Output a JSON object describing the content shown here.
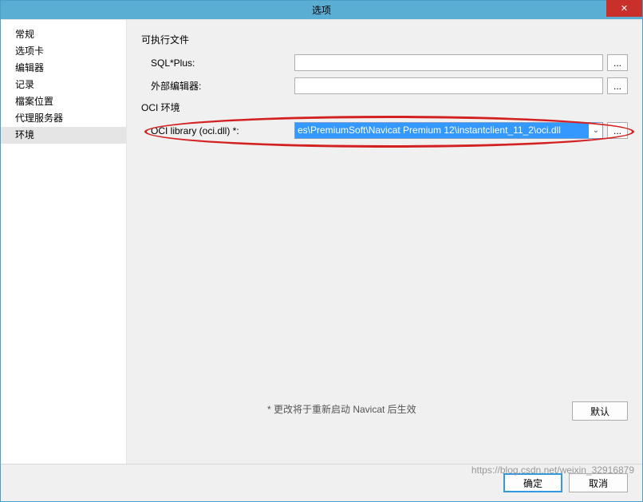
{
  "titlebar": {
    "title": "选项",
    "close": "✕"
  },
  "sidebar": {
    "items": [
      {
        "label": "常规"
      },
      {
        "label": "选项卡"
      },
      {
        "label": "编辑器"
      },
      {
        "label": "记录"
      },
      {
        "label": "檔案位置"
      },
      {
        "label": "代理服务器"
      },
      {
        "label": "环境"
      }
    ],
    "selected_index": 6
  },
  "content": {
    "exec_section": "可执行文件",
    "sqlplus_label": "SQL*Plus:",
    "sqlplus_value": "",
    "ext_editor_label": "外部编辑器:",
    "ext_editor_value": "",
    "oci_section": "OCI 环境",
    "oci_lib_label": "OCI library (oci.dll) *:",
    "oci_lib_value": "es\\PremiumSoft\\Navicat Premium 12\\instantclient_11_2\\oci.dll",
    "browse": "...",
    "note": "* 更改将于重新启动 Navicat 后生效",
    "default_btn": "默认"
  },
  "footer": {
    "ok": "确定",
    "cancel": "取消"
  },
  "watermark": "https://blog.csdn.net/weixin_32916879"
}
